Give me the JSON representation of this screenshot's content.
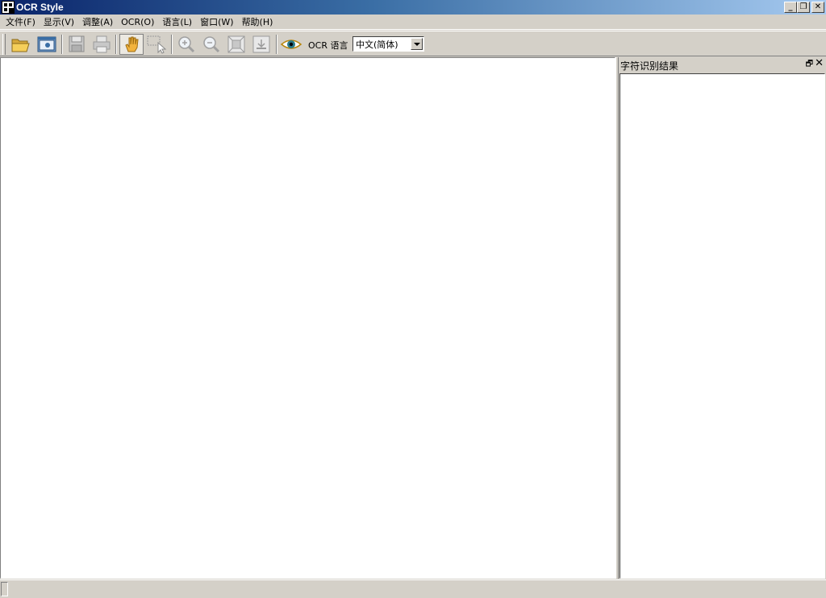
{
  "window": {
    "title": "OCR Style",
    "minimize_glyph": "_",
    "restore_glyph": "❐",
    "close_glyph": "✕"
  },
  "menu": [
    "文件(F)",
    "显示(V)",
    "调整(A)",
    "OCR(O)",
    "语言(L)",
    "窗口(W)",
    "帮助(H)"
  ],
  "toolbar": {
    "buttons": [
      "open-folder-icon",
      "scan-icon",
      "save-icon",
      "print-icon",
      "hand-pan-icon",
      "select-arrow-icon",
      "zoom-in-icon",
      "zoom-out-icon",
      "fit-page-icon",
      "actual-size-icon",
      "eye-recognize-icon"
    ],
    "ocr_language_label": "OCR 语言",
    "language_value": "中文(简体)"
  },
  "dock": {
    "title": "字符识别结果",
    "float_glyph": "🗗",
    "close_glyph": "✕"
  }
}
